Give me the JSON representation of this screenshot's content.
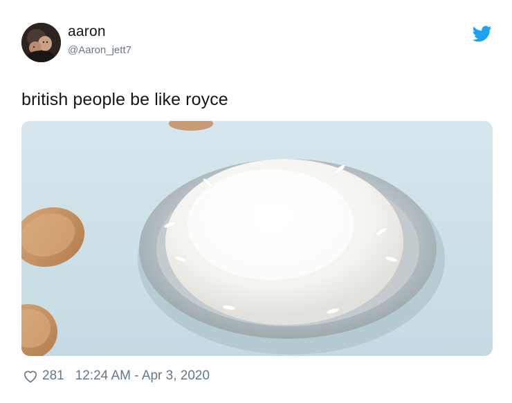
{
  "tweet": {
    "author": {
      "display_name": "aaron",
      "handle": "@Aaron_jett7"
    },
    "text": "british people be like royce",
    "media": {
      "icon": "rice-plate-photo"
    },
    "footer": {
      "like_count": "281",
      "timestamp": "12:24 AM - Apr 3, 2020"
    }
  },
  "colors": {
    "text": "#14171a",
    "secondary_text": "#657786",
    "twitter_blue": "#1da1f2"
  }
}
